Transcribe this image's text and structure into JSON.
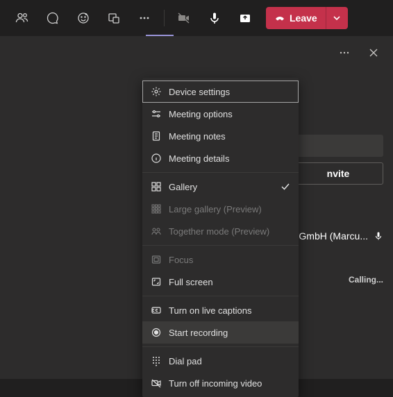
{
  "toolbar": {
    "leave_label": "Leave"
  },
  "panel": {
    "invite_label": "nvite",
    "participant_label": "GmbH (Marcu...",
    "calling_label": "Calling..."
  },
  "menu": {
    "device_settings": "Device settings",
    "meeting_options": "Meeting options",
    "meeting_notes": "Meeting notes",
    "meeting_details": "Meeting details",
    "gallery": "Gallery",
    "large_gallery": "Large gallery (Preview)",
    "together_mode": "Together mode (Preview)",
    "focus": "Focus",
    "full_screen": "Full screen",
    "live_captions": "Turn on live captions",
    "start_recording": "Start recording",
    "dial_pad": "Dial pad",
    "turn_off_incoming": "Turn off incoming video"
  }
}
